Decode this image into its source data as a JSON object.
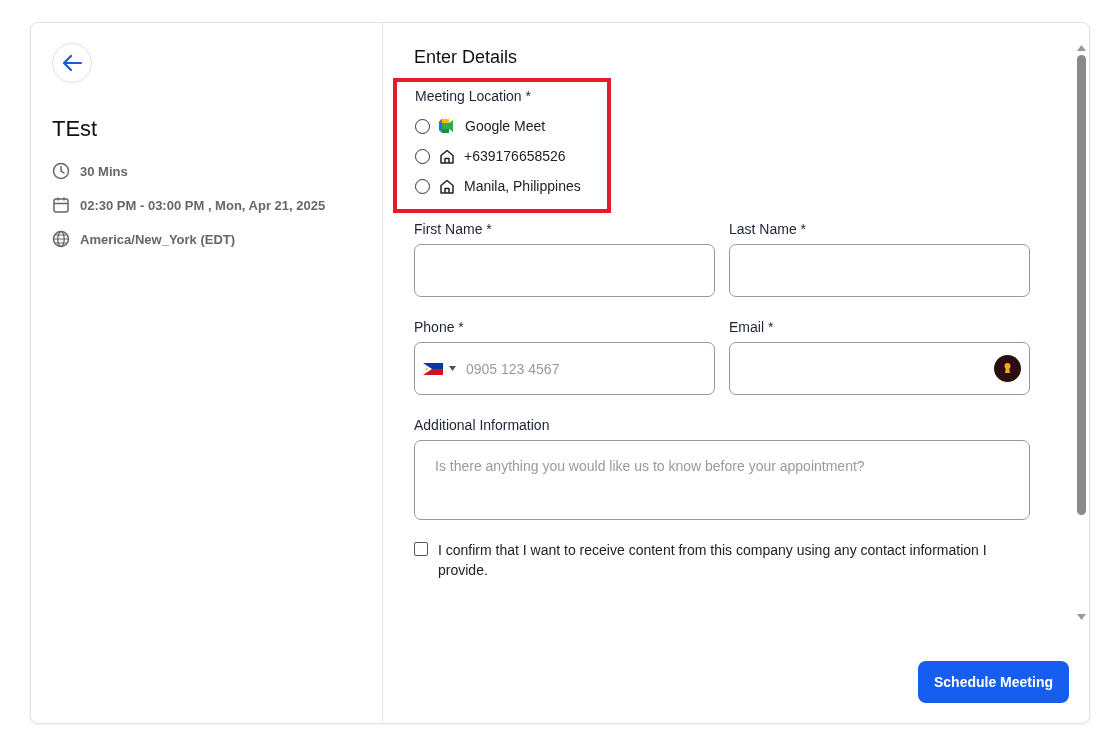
{
  "event": {
    "title": "TEst",
    "details": [
      {
        "kind": "duration",
        "text": "30 Mins"
      },
      {
        "kind": "date",
        "text": "02:30 PM - 03:00 PM , Mon, Apr 21, 2025"
      },
      {
        "kind": "timezone",
        "text": "America/New_York (EDT)"
      }
    ]
  },
  "form": {
    "heading": "Enter Details",
    "location": {
      "label": "Meeting Location *",
      "highlighted": true,
      "options": [
        {
          "kind": "video",
          "label": "Google Meet",
          "selected": false
        },
        {
          "kind": "home",
          "label": "+639176658526",
          "selected": false
        },
        {
          "kind": "home",
          "label": "Manila, Philippines",
          "selected": false
        }
      ]
    },
    "first_name": {
      "label": "First Name *"
    },
    "last_name": {
      "label": "Last Name *"
    },
    "phone": {
      "label": "Phone *",
      "placeholder": "0905 123 4567"
    },
    "email": {
      "label": "Email *"
    },
    "additional": {
      "label": "Additional Information",
      "placeholder": "Is there anything you would like us to know before your appointment?"
    },
    "consent": {
      "text": "I confirm that I want to receive content from this company using any contact information I provide.",
      "checked": false
    },
    "submit": "Schedule Meeting"
  }
}
